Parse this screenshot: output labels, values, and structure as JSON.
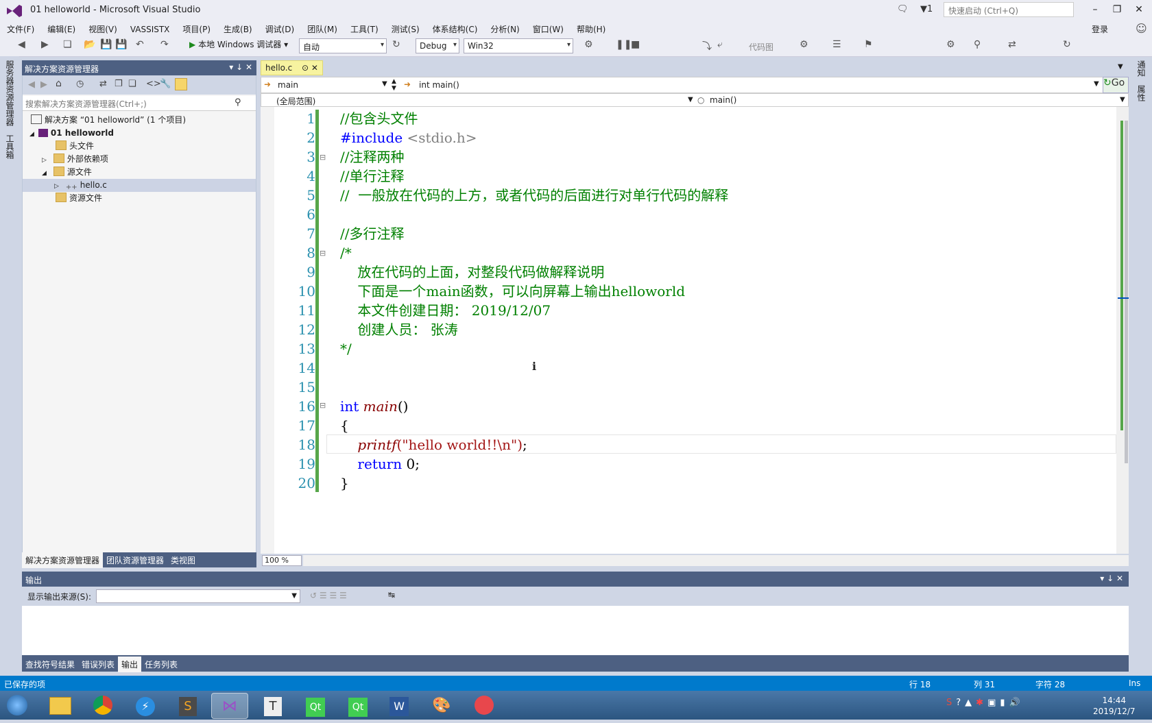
{
  "window": {
    "title": "01 helloworld - Microsoft Visual Studio",
    "notif_count": "1",
    "quick_launch_placeholder": "快速启动 (Ctrl+Q)",
    "login": "登录"
  },
  "menu": [
    "文件(F)",
    "编辑(E)",
    "视图(V)",
    "VASSISTX",
    "项目(P)",
    "生成(B)",
    "调试(D)",
    "团队(M)",
    "工具(T)",
    "测试(S)",
    "体系结构(C)",
    "分析(N)",
    "窗口(W)",
    "帮助(H)"
  ],
  "toolbar": {
    "run_label": "本地 Windows 调试器",
    "mode": "自动",
    "config": "Debug",
    "platform": "Win32",
    "codemap": "代码图"
  },
  "side_tabs": {
    "server": "服务器资源管理器",
    "toolbox": "工具箱",
    "right1": "通知",
    "right2": "属性"
  },
  "solution_explorer": {
    "title": "解决方案资源管理器",
    "search_placeholder": "搜索解决方案资源管理器(Ctrl+;)",
    "tree": [
      {
        "label": "解决方案 “01 helloworld” (1 个项目)",
        "indent": 0,
        "icon": "solution-icon"
      },
      {
        "label": "01 helloworld",
        "indent": 1,
        "icon": "project-icon",
        "bold": true
      },
      {
        "label": "头文件",
        "indent": 2,
        "icon": "folder-icon"
      },
      {
        "label": "外部依赖项",
        "indent": 2,
        "icon": "folder-icon"
      },
      {
        "label": "源文件",
        "indent": 2,
        "icon": "folder-icon"
      },
      {
        "label": "hello.c",
        "indent": 3,
        "icon": "c-file-icon",
        "selected": true
      },
      {
        "label": "资源文件",
        "indent": 2,
        "icon": "folder-icon"
      }
    ],
    "tabs": [
      "解决方案资源管理器",
      "团队资源管理器",
      "类视图"
    ]
  },
  "editor": {
    "file_tab": "hello.c",
    "nav_scope": "main",
    "nav_member": "int main()",
    "nav_global": "(全局范围)",
    "nav_func": "main()",
    "go": "Go",
    "zoom": "100 %",
    "lines": [
      {
        "n": "1",
        "text": "//包含头文件",
        "cls": "c-com"
      },
      {
        "n": "2",
        "text": "#include",
        "text2": " <stdio.h>",
        "cls": "c-kw"
      },
      {
        "n": "3",
        "text": "//注释两种",
        "cls": "c-com"
      },
      {
        "n": "4",
        "text": "//单行注释",
        "cls": "c-com"
      },
      {
        "n": "5",
        "text": "//  一般放在代码的上方，或者代码的后面进行对单行代码的解释",
        "cls": "c-com"
      },
      {
        "n": "6",
        "text": "",
        "cls": "code"
      },
      {
        "n": "7",
        "text": "//多行注释",
        "cls": "c-com"
      },
      {
        "n": "8",
        "text": "/*",
        "cls": "c-com"
      },
      {
        "n": "9",
        "text": "    放在代码的上面，对整段代码做解释说明",
        "cls": "c-com"
      },
      {
        "n": "10",
        "text": "    下面是一个main函数，可以向屏幕上输出helloworld",
        "cls": "c-com"
      },
      {
        "n": "11",
        "text": "    本文件创建日期： 2019/12/07",
        "cls": "c-com"
      },
      {
        "n": "12",
        "text": "    创建人员： 张涛",
        "cls": "c-com"
      },
      {
        "n": "13",
        "text": "*/",
        "cls": "c-com"
      },
      {
        "n": "14",
        "text": "",
        "cls": "code"
      },
      {
        "n": "15",
        "text": "",
        "cls": "code"
      },
      {
        "n": "16",
        "text": "int",
        "text2": " main",
        "text3": "()",
        "cls": "c-kw"
      },
      {
        "n": "17",
        "text": "{",
        "cls": "code"
      },
      {
        "n": "18",
        "text": "    printf",
        "text2": "(\"hello world!!\\n\")",
        "text3": ";",
        "cls": "c-fn"
      },
      {
        "n": "19",
        "text": "    return",
        "text2": " 0;",
        "cls": "c-kw"
      },
      {
        "n": "20",
        "text": "}",
        "cls": "code"
      }
    ]
  },
  "output": {
    "title": "输出",
    "source_label": "显示输出来源(S):",
    "tabs": [
      "查找符号结果",
      "错误列表",
      "输出",
      "任务列表"
    ]
  },
  "status": {
    "left": "已保存的项",
    "row": "行 18",
    "col": "列 31",
    "char": "字符 28",
    "ins": "Ins"
  },
  "taskbar": {
    "time": "14:44",
    "date": "2019/12/7"
  },
  "colors": {
    "accent": "#007acc",
    "panel_header": "#4d6082",
    "comment": "#008000",
    "keyword": "#0000ff"
  }
}
